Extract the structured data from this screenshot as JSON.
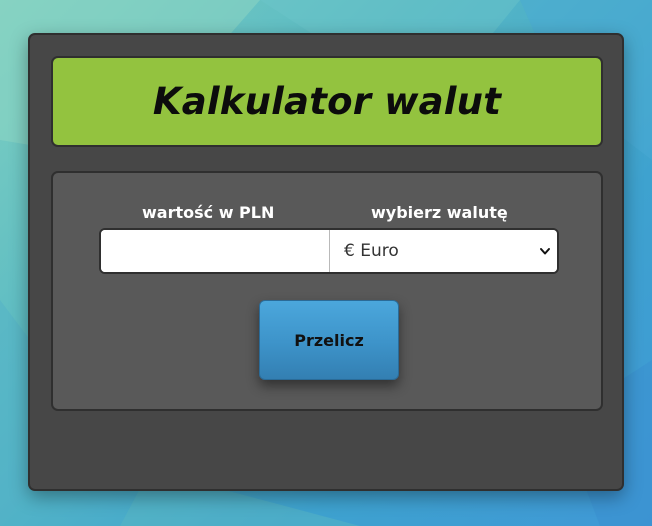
{
  "header": {
    "title": "Kalkulator walut"
  },
  "form": {
    "amount_label": "wartość w PLN",
    "amount_value": "",
    "currency_label": "wybierz walutę",
    "currency_selected": "€ Euro",
    "convert_label": "Przelicz"
  },
  "colors": {
    "header_bg": "#93c33f",
    "card_bg": "#474747",
    "panel_bg": "#595959",
    "button_bg": "#3d93c9"
  },
  "icons": {
    "select_arrow": "chevron-down-icon"
  }
}
